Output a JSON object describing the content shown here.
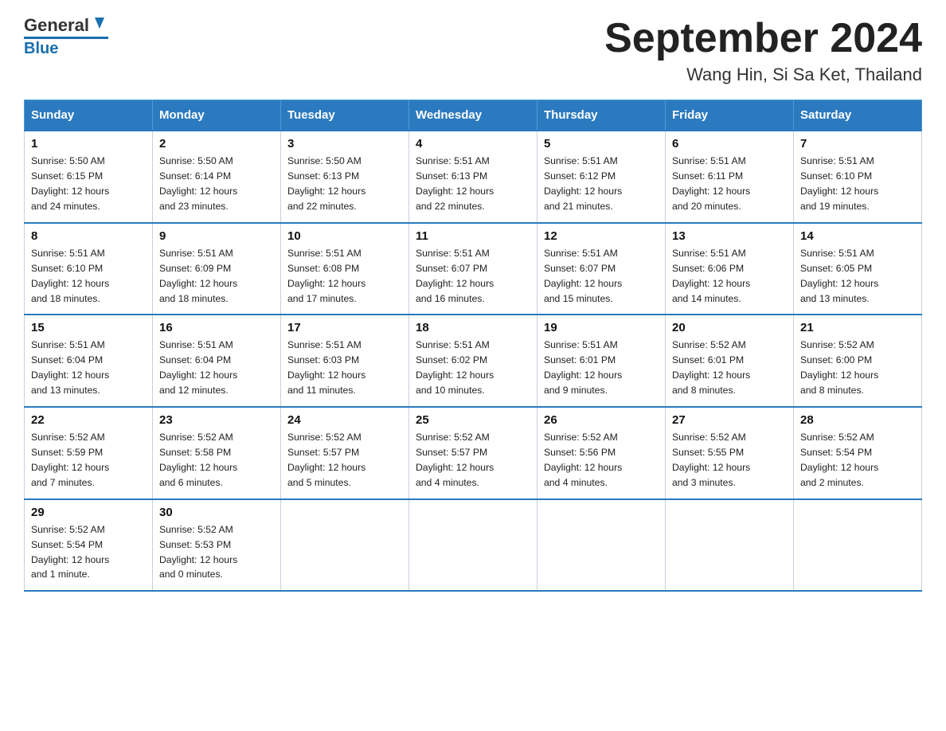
{
  "header": {
    "logo_general": "General",
    "logo_blue": "Blue",
    "month_title": "September 2024",
    "location": "Wang Hin, Si Sa Ket, Thailand"
  },
  "days_of_week": [
    "Sunday",
    "Monday",
    "Tuesday",
    "Wednesday",
    "Thursday",
    "Friday",
    "Saturday"
  ],
  "weeks": [
    [
      {
        "day": "1",
        "sunrise": "5:50 AM",
        "sunset": "6:15 PM",
        "daylight": "12 hours and 24 minutes."
      },
      {
        "day": "2",
        "sunrise": "5:50 AM",
        "sunset": "6:14 PM",
        "daylight": "12 hours and 23 minutes."
      },
      {
        "day": "3",
        "sunrise": "5:50 AM",
        "sunset": "6:13 PM",
        "daylight": "12 hours and 22 minutes."
      },
      {
        "day": "4",
        "sunrise": "5:51 AM",
        "sunset": "6:13 PM",
        "daylight": "12 hours and 22 minutes."
      },
      {
        "day": "5",
        "sunrise": "5:51 AM",
        "sunset": "6:12 PM",
        "daylight": "12 hours and 21 minutes."
      },
      {
        "day": "6",
        "sunrise": "5:51 AM",
        "sunset": "6:11 PM",
        "daylight": "12 hours and 20 minutes."
      },
      {
        "day": "7",
        "sunrise": "5:51 AM",
        "sunset": "6:10 PM",
        "daylight": "12 hours and 19 minutes."
      }
    ],
    [
      {
        "day": "8",
        "sunrise": "5:51 AM",
        "sunset": "6:10 PM",
        "daylight": "12 hours and 18 minutes."
      },
      {
        "day": "9",
        "sunrise": "5:51 AM",
        "sunset": "6:09 PM",
        "daylight": "12 hours and 18 minutes."
      },
      {
        "day": "10",
        "sunrise": "5:51 AM",
        "sunset": "6:08 PM",
        "daylight": "12 hours and 17 minutes."
      },
      {
        "day": "11",
        "sunrise": "5:51 AM",
        "sunset": "6:07 PM",
        "daylight": "12 hours and 16 minutes."
      },
      {
        "day": "12",
        "sunrise": "5:51 AM",
        "sunset": "6:07 PM",
        "daylight": "12 hours and 15 minutes."
      },
      {
        "day": "13",
        "sunrise": "5:51 AM",
        "sunset": "6:06 PM",
        "daylight": "12 hours and 14 minutes."
      },
      {
        "day": "14",
        "sunrise": "5:51 AM",
        "sunset": "6:05 PM",
        "daylight": "12 hours and 13 minutes."
      }
    ],
    [
      {
        "day": "15",
        "sunrise": "5:51 AM",
        "sunset": "6:04 PM",
        "daylight": "12 hours and 13 minutes."
      },
      {
        "day": "16",
        "sunrise": "5:51 AM",
        "sunset": "6:04 PM",
        "daylight": "12 hours and 12 minutes."
      },
      {
        "day": "17",
        "sunrise": "5:51 AM",
        "sunset": "6:03 PM",
        "daylight": "12 hours and 11 minutes."
      },
      {
        "day": "18",
        "sunrise": "5:51 AM",
        "sunset": "6:02 PM",
        "daylight": "12 hours and 10 minutes."
      },
      {
        "day": "19",
        "sunrise": "5:51 AM",
        "sunset": "6:01 PM",
        "daylight": "12 hours and 9 minutes."
      },
      {
        "day": "20",
        "sunrise": "5:52 AM",
        "sunset": "6:01 PM",
        "daylight": "12 hours and 8 minutes."
      },
      {
        "day": "21",
        "sunrise": "5:52 AM",
        "sunset": "6:00 PM",
        "daylight": "12 hours and 8 minutes."
      }
    ],
    [
      {
        "day": "22",
        "sunrise": "5:52 AM",
        "sunset": "5:59 PM",
        "daylight": "12 hours and 7 minutes."
      },
      {
        "day": "23",
        "sunrise": "5:52 AM",
        "sunset": "5:58 PM",
        "daylight": "12 hours and 6 minutes."
      },
      {
        "day": "24",
        "sunrise": "5:52 AM",
        "sunset": "5:57 PM",
        "daylight": "12 hours and 5 minutes."
      },
      {
        "day": "25",
        "sunrise": "5:52 AM",
        "sunset": "5:57 PM",
        "daylight": "12 hours and 4 minutes."
      },
      {
        "day": "26",
        "sunrise": "5:52 AM",
        "sunset": "5:56 PM",
        "daylight": "12 hours and 4 minutes."
      },
      {
        "day": "27",
        "sunrise": "5:52 AM",
        "sunset": "5:55 PM",
        "daylight": "12 hours and 3 minutes."
      },
      {
        "day": "28",
        "sunrise": "5:52 AM",
        "sunset": "5:54 PM",
        "daylight": "12 hours and 2 minutes."
      }
    ],
    [
      {
        "day": "29",
        "sunrise": "5:52 AM",
        "sunset": "5:54 PM",
        "daylight": "12 hours and 1 minute."
      },
      {
        "day": "30",
        "sunrise": "5:52 AM",
        "sunset": "5:53 PM",
        "daylight": "12 hours and 0 minutes."
      },
      null,
      null,
      null,
      null,
      null
    ]
  ]
}
